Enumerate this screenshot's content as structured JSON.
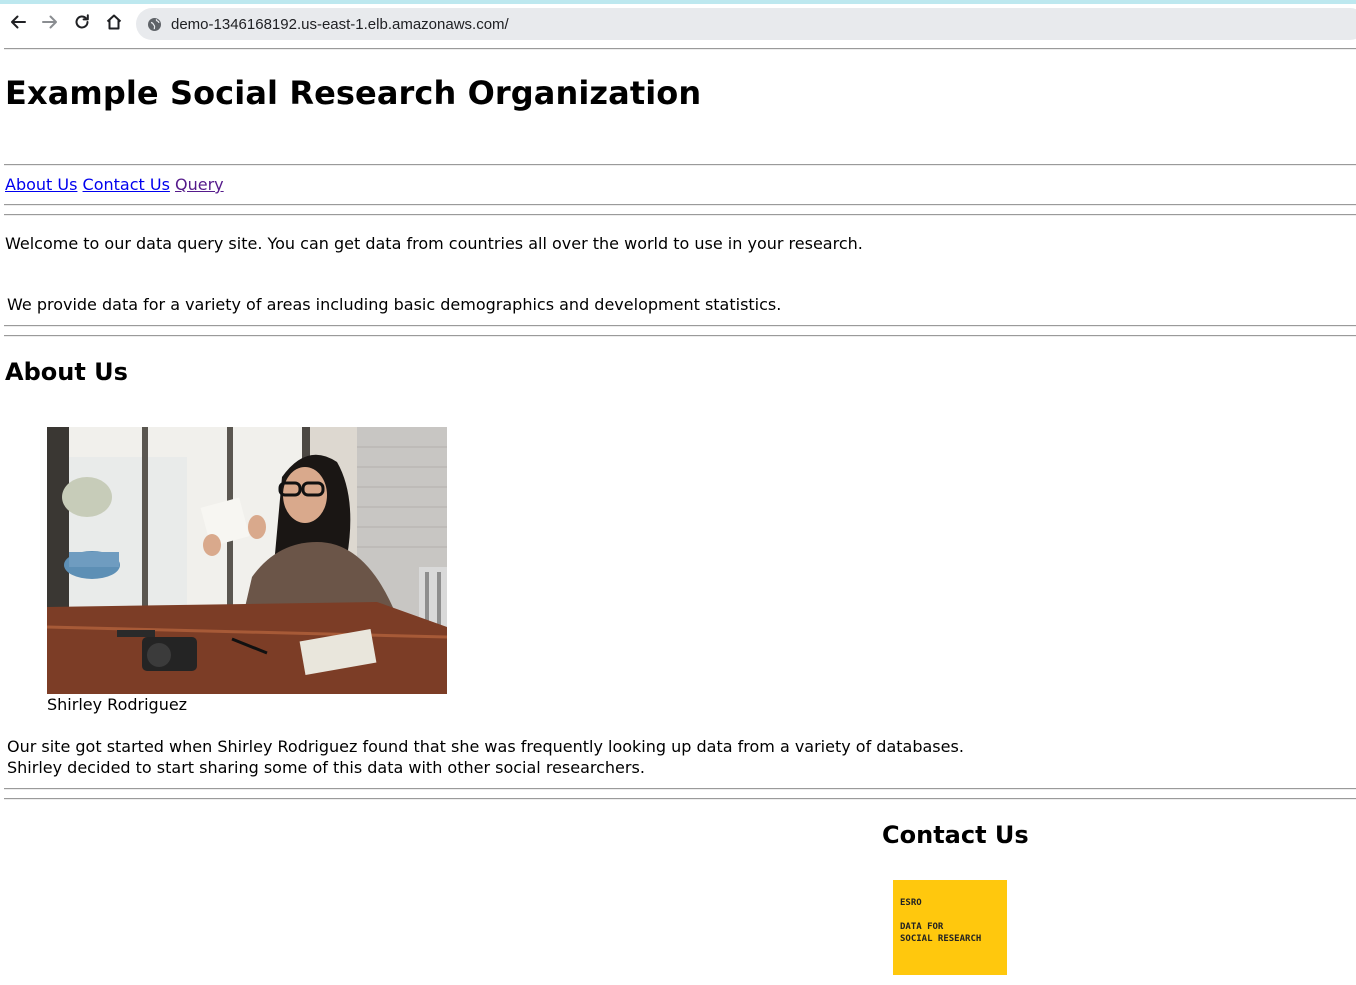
{
  "browser": {
    "url": "demo-1346168192.us-east-1.elb.amazonaws.com/",
    "icons": [
      "back-arrow-icon",
      "forward-arrow-icon",
      "reload-icon",
      "home-icon",
      "site-info-icon"
    ]
  },
  "header": {
    "title": "Example Social Research Organization"
  },
  "nav": {
    "links": [
      {
        "label": "About Us",
        "state": "unvisited"
      },
      {
        "label": "Contact Us",
        "state": "unvisited"
      },
      {
        "label": "Query",
        "state": "visited"
      }
    ]
  },
  "intro": {
    "welcome": "Welcome to our data query site. You can get data from countries all over the world to use in your research.",
    "provide": "We provide data for a variety of areas including basic demographics and development statistics."
  },
  "about": {
    "heading": "About Us",
    "photo_alt": "Woman with glasses reading at a cafe table",
    "caption": "Shirley Rodriguez",
    "story_line1": "Our site got started when Shirley Rodriguez found that she was frequently looking up data from a variety of databases.",
    "story_line2": "Shirley decided to start sharing some of this data with other social researchers."
  },
  "contact": {
    "heading": "Contact Us",
    "logo": {
      "line1": "ESRO",
      "line2": "DATA FOR",
      "line3": "SOCIAL RESEARCH",
      "bg_color": "#ffc80d"
    }
  },
  "colors": {
    "link": "#0000ee",
    "visited_link": "#551a8b",
    "omnibox_bg": "#e8eaed",
    "top_stripe": "#bde8ef"
  }
}
